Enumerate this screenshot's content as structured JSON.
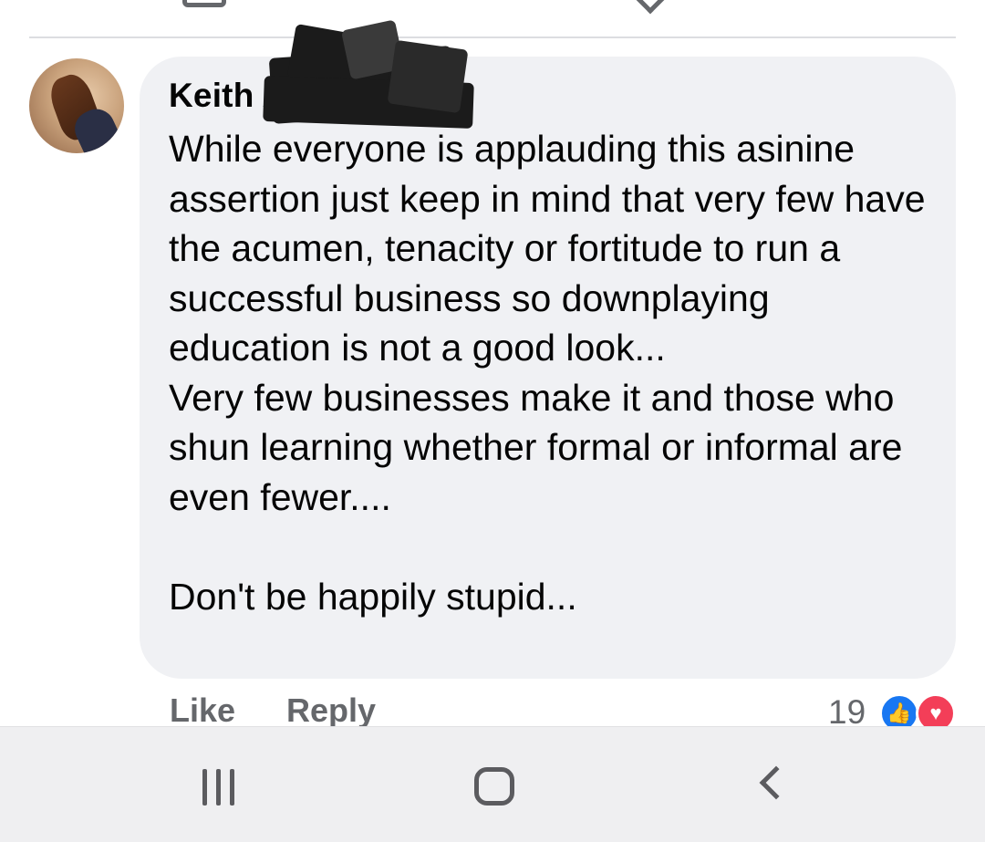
{
  "comment": {
    "author_name": "Keith A",
    "body": "While everyone is applauding this asinine assertion just keep in mind that very few have the acumen, tenacity or fortitude to run a successful business so downplaying education is not a good look...\nVery few businesses make it and those who shun learning whether formal or informal are even fewer....\n\nDon't be happily stupid..."
  },
  "actions": {
    "like_label": "Like",
    "reply_label": "Reply"
  },
  "reactions": {
    "count": "19",
    "types": [
      "like-icon",
      "love-icon"
    ]
  },
  "icons": {
    "avatar": "avatar-shoes-photo",
    "top_left": "comment-icon",
    "top_right": "share-icon",
    "nav_recents": "recent-apps-icon",
    "nav_home": "home-icon",
    "nav_back": "back-icon"
  },
  "colors": {
    "bubble_bg": "#f0f1f4",
    "secondary_text": "#65676b",
    "like_blue": "#1877f2",
    "love_red": "#f33e58",
    "navbar_bg": "#efeff1"
  }
}
